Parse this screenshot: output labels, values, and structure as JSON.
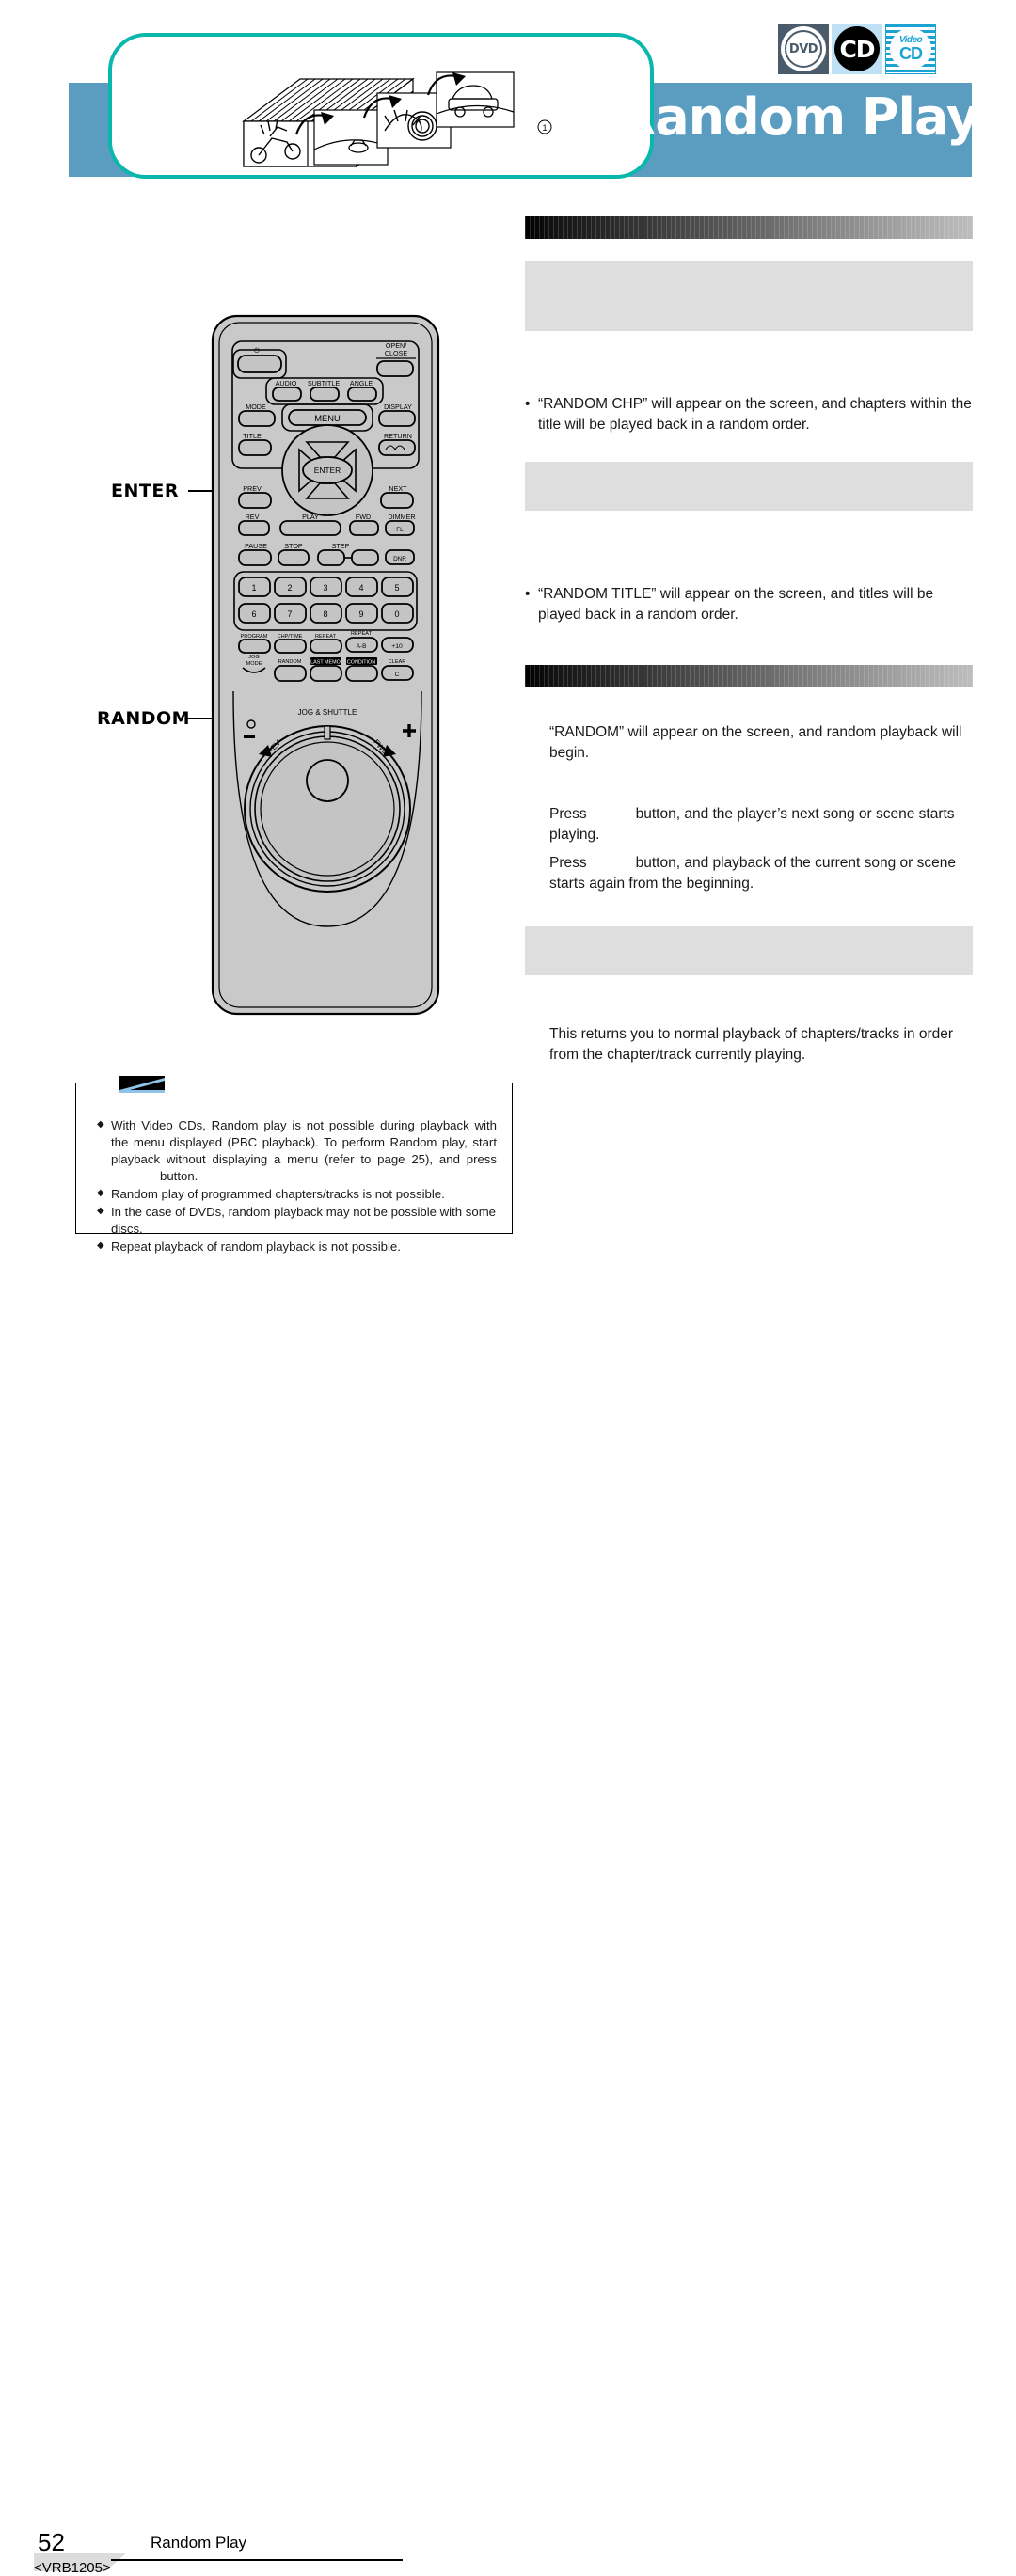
{
  "header": {
    "title": "Random Play",
    "band_color": "#5b9dc0",
    "pill_border_color": "#09b7ad",
    "disc_logos": [
      {
        "name": "dvd-logo",
        "label": "DVD",
        "bg": "#4a5b6b"
      },
      {
        "name": "cd-logo",
        "label": "CD",
        "bg": "#bfe0f5"
      },
      {
        "name": "video-cd-logo",
        "label_top": "Video",
        "label_bottom": "CD",
        "bg": "#1ba3d4"
      }
    ],
    "illustration": {
      "name": "shuffled-discs-illustration",
      "callout_number": "①"
    }
  },
  "remote": {
    "name": "dvd-remote-control",
    "callouts": [
      {
        "label": "ENTER",
        "target": "enter-button"
      },
      {
        "label": "RANDOM",
        "target": "random-button"
      }
    ],
    "power_icon": "⏻",
    "buttons": {
      "open_close": "OPEN/\nCLOSE",
      "open": "OPEN/",
      "close": "CLOSE",
      "audio": "AUDIO",
      "subtitle": "SUBTITLE",
      "angle": "ANGLE",
      "mode": "MODE",
      "menu": "MENU",
      "display": "DISPLAY",
      "title": "TITLE",
      "return": "RETURN",
      "enter": "ENTER",
      "prev": "PREV",
      "next": "NEXT",
      "rev": "REV",
      "play": "PLAY",
      "fwd": "FWD",
      "dimmer": "DIMMER",
      "fl": "FL",
      "pause": "PAUSE",
      "stop": "STOP",
      "step": "STEP",
      "dnr": "DNR",
      "numbers": [
        "1",
        "2",
        "3",
        "4",
        "5",
        "6",
        "7",
        "8",
        "9",
        "0"
      ],
      "program": "PROGRAM",
      "chp_time": "CHP/TIME",
      "repeat": "REPEAT",
      "repeat_ab_label": "REPEAT",
      "repeat_ab": "A-B",
      "plus_ten": "+10",
      "jog_mode": "JOG\nMODE",
      "jog": "JOG",
      "mode2": "MODE",
      "random": "RANDOM",
      "last_memo": "LAST MEMO",
      "condition": "CONDITION",
      "clear": "CLEAR",
      "clear_c": "C",
      "jog_shuttle": "JOG & SHUTTLE",
      "shuttle_rev": "REV",
      "shuttle_fwd": "FWD"
    }
  },
  "content": {
    "sections": [
      {
        "name": "section-1",
        "heading_bar": true,
        "gray_blocks": [
          {
            "height": 74
          }
        ],
        "bullets": [
          "“RANDOM CHP” will appear on the screen, and chapters within the title will be played back in a random order."
        ]
      },
      {
        "name": "section-2",
        "heading_bar": false,
        "gray_blocks": [
          {
            "height": 52
          }
        ],
        "bullets": [
          "“RANDOM TITLE” will appear on the screen, and titles will be played back in a random order."
        ]
      },
      {
        "name": "section-3",
        "heading_bar": true,
        "paragraphs": [
          "“RANDOM” will appear on the screen, and random playback will begin."
        ],
        "press_lines": [
          {
            "pre": "Press",
            "post": "button, and the player’s next song or scene starts playing."
          },
          {
            "pre": "Press",
            "post": "button, and playback of the current song or scene starts again from the beginning."
          }
        ]
      },
      {
        "name": "section-4",
        "gray_blocks": [
          {
            "height": 52
          }
        ],
        "paragraphs": [
          "This returns you to normal playback of chapters/tracks in order from the chapter/track currently playing."
        ]
      }
    ]
  },
  "note_box": {
    "name": "note-callout-box",
    "icon": "note-wedge-icon",
    "items": [
      "With Video CDs, Random play is not possible during playback with the menu displayed (PBC playback). To perform Random play, start playback without displaying a menu (refer to page 25), and press",
      "Random play of programmed chapters/tracks is not possible.",
      "In the case of DVDs, random playback may not be possible with some discs.",
      "Repeat playback of random playback is not possible."
    ],
    "item1_tail": "button."
  },
  "footer": {
    "page_number": "52",
    "section_title": "Random Play",
    "doc_code": "<VRB1205>"
  }
}
